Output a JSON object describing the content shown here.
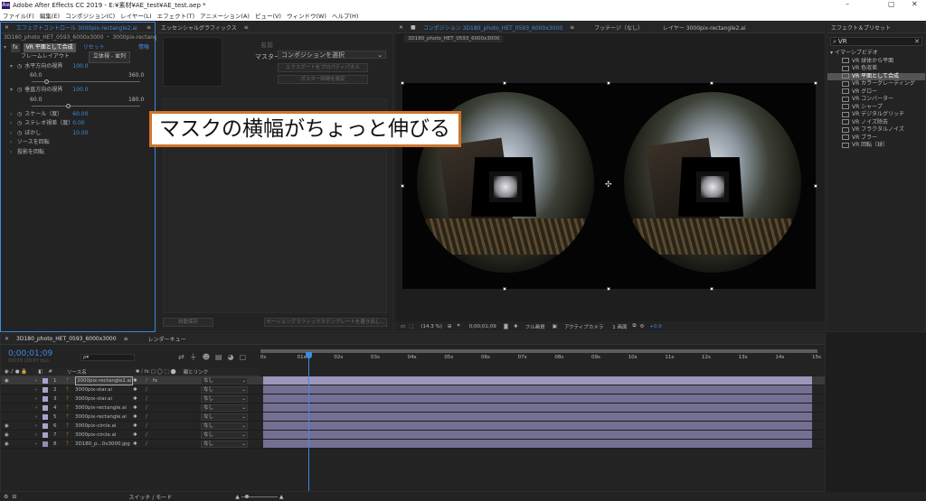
{
  "titlebar": {
    "title": "Adobe After Effects CC 2019 - E:¥素材¥AE_test¥AE_test.aep *",
    "logo": "Ae",
    "minimize": "–",
    "maximize": "▢",
    "close": "✕"
  },
  "menu": [
    "ファイル(F)",
    "編集(E)",
    "コンポジション(C)",
    "レイヤー(L)",
    "エフェクト(T)",
    "アニメーション(A)",
    "ビュー(V)",
    "ウィンドウ(W)",
    "ヘルプ(H)"
  ],
  "effect_controls": {
    "tab": "エフェクトコントロール 3000pix-rectangle2.ai",
    "breadcrumb": "3D180_photo_HET_0593_6000x3000 ・ 3000pix-rectangle2.ai",
    "effect_name": "VR 平面として合成",
    "reset": "リセット",
    "about": "情報",
    "params": [
      {
        "label": "フレームレイアウト",
        "value": "立体視 - 並列"
      },
      {
        "label": "水平方向の視界",
        "value": "100.0",
        "min": "60.0",
        "max": "360.0",
        "fraction": 0.13
      },
      {
        "label": "垂直方向の視界",
        "value": "100.0",
        "min": "60.0",
        "max": "180.0",
        "fraction": 0.33
      },
      {
        "label": "スケール（度）",
        "value": "60.00"
      },
      {
        "label": "ステレオ視差（度）",
        "value": "0.00"
      },
      {
        "label": "ぼかし",
        "value": "10.00"
      },
      {
        "label": "ソースを回転",
        "value": ""
      },
      {
        "label": "投影を回転",
        "value": ""
      }
    ]
  },
  "essential_graphics": {
    "tab": "エッセンシャルグラフィックス",
    "name_label": "名前",
    "master_label": "マスター",
    "master_value": "コンポジションを選択",
    "btn_export": "エクスポートをプロパティパネル",
    "btn_poster": "ポスター時間を設定",
    "btn_template": "自動保存",
    "btn_export_mogrt": "モーショングラフィックステンプレートを書き出し..."
  },
  "composition": {
    "tab": "コンポジション 3D180_photo_HET_0593_6000x3000",
    "footage_tab": "フッテージ（なし）",
    "layer_tab": "レイヤー 3000pix-rectangle2.ai",
    "subtab": "3D180_photo_HET_0593_6000x3000",
    "footer": {
      "zoom": "(14.3 %)",
      "timecode": "0;00;01;09",
      "resolution": "フル画質",
      "camera": "アクティブカメラ",
      "views": "1 画面",
      "exposure": "+0.0"
    }
  },
  "caption": "マスクの横幅がちょっと伸びる",
  "effects_presets": {
    "tab": "エフェクト＆プリセット",
    "search": "VR",
    "category": "イマーシブビデオ",
    "items": [
      "VR 球体から平面",
      "VR 色収差",
      "VR 平面として合成",
      "VR カラーグレーディング",
      "VR グロー",
      "VR コンバーター",
      "VR シャープ",
      "VR デジタルグリッチ",
      "VR ノイズ除去",
      "VR フラクタルノイズ",
      "VR ブラー",
      "VR 回転（球）"
    ],
    "selected_index": 2
  },
  "timeline": {
    "tab": "3D180_photo_HET_0593_6000x3000",
    "render_tab": "レンダーキュー",
    "timecode": "0;00;01;09",
    "frames": "00039 (29.97 fps)",
    "search_placeholder": "ρ▾",
    "col_source": "ソース名",
    "col_parent": "親とリンク",
    "ruler": [
      "0s",
      "01s",
      "02s",
      "03s",
      "04s",
      "05s",
      "06s",
      "07s",
      "08s",
      "09s",
      "10s",
      "11s",
      "12s",
      "13s",
      "14s",
      "15s"
    ],
    "playhead_fraction": 0.087,
    "layers": [
      {
        "num": "1",
        "name": "3000pix-rectangle2.ai",
        "parent": "なし",
        "color": "#a8a3c9",
        "selected": true,
        "eye": true
      },
      {
        "num": "2",
        "name": "3000pix-star.ai",
        "parent": "なし",
        "color": "#a8a3c9",
        "selected": false,
        "eye": false
      },
      {
        "num": "3",
        "name": "3000pix-star.ai",
        "parent": "なし",
        "color": "#a8a3c9",
        "selected": false,
        "eye": false
      },
      {
        "num": "4",
        "name": "3000pix-rectangle.ai",
        "parent": "なし",
        "color": "#a8a3c9",
        "selected": false,
        "eye": false
      },
      {
        "num": "5",
        "name": "3000pix-rectangle.ai",
        "parent": "なし",
        "color": "#a8a3c9",
        "selected": false,
        "eye": false
      },
      {
        "num": "6",
        "name": "3000pix-circle.ai",
        "parent": "なし",
        "color": "#a8a3c9",
        "selected": false,
        "eye": true
      },
      {
        "num": "7",
        "name": "3000pix-circle.ai",
        "parent": "なし",
        "color": "#a8a3c9",
        "selected": false,
        "eye": true
      },
      {
        "num": "8",
        "name": "3D180_p...0x3000.jpg",
        "parent": "なし",
        "color": "#8f8fb0",
        "selected": false,
        "eye": true
      }
    ],
    "footer_toggle": "スイッチ / モード"
  }
}
